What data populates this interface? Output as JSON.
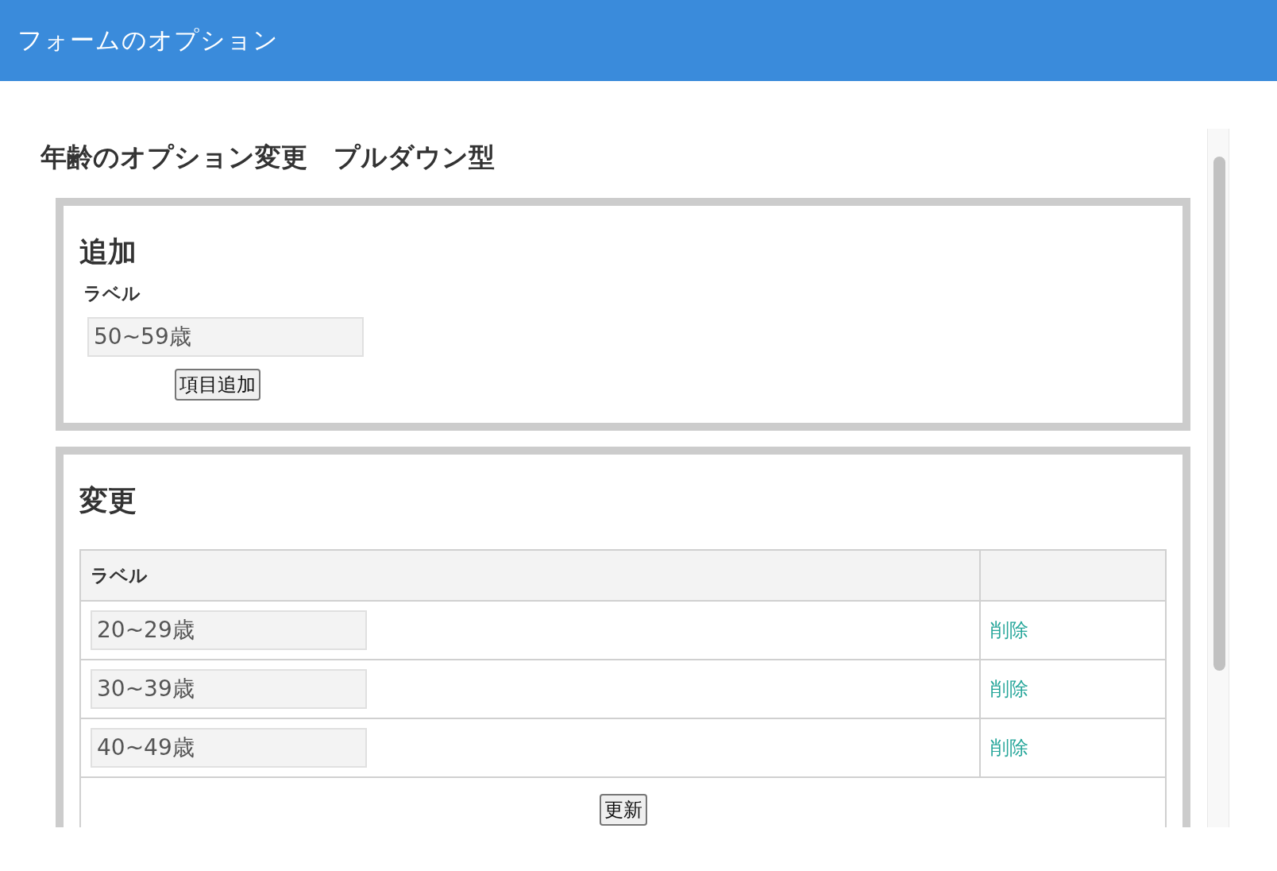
{
  "header": {
    "title": "フォームのオプション"
  },
  "page": {
    "heading": "年齢のオプション変更　プルダウン型"
  },
  "add_section": {
    "title": "追加",
    "field_label": "ラベル",
    "field_value": "50~59歳",
    "button": "項目追加"
  },
  "edit_section": {
    "title": "変更",
    "columns": [
      "ラベル"
    ],
    "rows": [
      {
        "value": "20~29歳",
        "action": "削除"
      },
      {
        "value": "30~39歳",
        "action": "削除"
      },
      {
        "value": "40~49歳",
        "action": "削除"
      }
    ],
    "button": "更新"
  }
}
